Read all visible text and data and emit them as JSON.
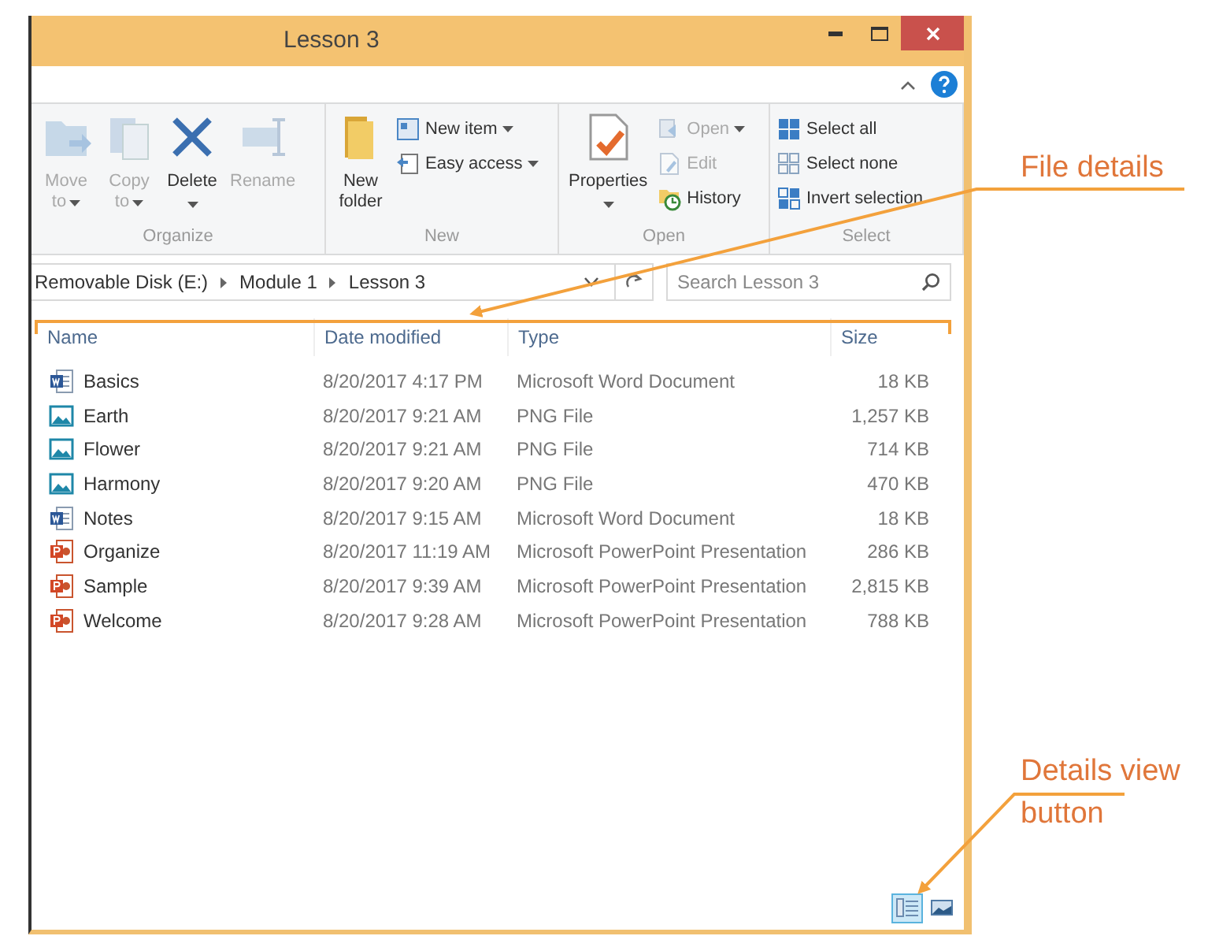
{
  "window": {
    "title": "Lesson 3"
  },
  "ribbon": {
    "groups": [
      {
        "label": "Organize",
        "buttons": [
          {
            "kind": "large",
            "label": "Move",
            "label2": "to",
            "disabled": true,
            "dropdown": true
          },
          {
            "kind": "large",
            "label": "Copy",
            "label2": "to",
            "disabled": true,
            "dropdown": true
          },
          {
            "kind": "large",
            "label": "Delete",
            "disabled": false,
            "dropdown": true
          },
          {
            "kind": "large",
            "label": "Rename",
            "disabled": true,
            "dropdown": false
          }
        ]
      },
      {
        "label": "New",
        "buttons": [
          {
            "kind": "large",
            "label": "New",
            "label2": "folder",
            "disabled": false,
            "dropdown": false
          },
          {
            "kind": "small",
            "label": "New item",
            "disabled": false,
            "dropdown": true
          },
          {
            "kind": "small",
            "label": "Easy access",
            "disabled": false,
            "dropdown": true
          }
        ]
      },
      {
        "label": "Open",
        "buttons": [
          {
            "kind": "large",
            "label": "Properties",
            "disabled": false,
            "dropdown": true
          },
          {
            "kind": "small",
            "label": "Open",
            "disabled": true,
            "dropdown": true
          },
          {
            "kind": "small",
            "label": "Edit",
            "disabled": true,
            "dropdown": false
          },
          {
            "kind": "small",
            "label": "History",
            "disabled": false,
            "dropdown": false
          }
        ]
      },
      {
        "label": "Select",
        "buttons": [
          {
            "kind": "small",
            "label": "Select all",
            "disabled": false,
            "dropdown": false
          },
          {
            "kind": "small",
            "label": "Select none",
            "disabled": false,
            "dropdown": false
          },
          {
            "kind": "small",
            "label": "Invert selection",
            "disabled": false,
            "dropdown": false
          }
        ]
      }
    ]
  },
  "address": {
    "path": [
      "Removable Disk (E:)",
      "Module 1",
      "Lesson 3"
    ],
    "search": {
      "placeholder": "Search Lesson 3"
    }
  },
  "table": {
    "columns": [
      "Name",
      "Date modified",
      "Type",
      "Size"
    ],
    "rows": [
      {
        "kind": "word",
        "name": "Basics",
        "date": "8/20/2017 4:17 PM",
        "type": "Microsoft Word Document",
        "size": "18 KB"
      },
      {
        "kind": "image",
        "name": "Earth",
        "date": "8/20/2017 9:21 AM",
        "type": "PNG File",
        "size": "1,257 KB"
      },
      {
        "kind": "image",
        "name": "Flower",
        "date": "8/20/2017 9:21 AM",
        "type": "PNG File",
        "size": "714 KB"
      },
      {
        "kind": "image",
        "name": "Harmony",
        "date": "8/20/2017 9:20 AM",
        "type": "PNG File",
        "size": "470 KB"
      },
      {
        "kind": "word",
        "name": "Notes",
        "date": "8/20/2017 9:15 AM",
        "type": "Microsoft Word Document",
        "size": "18 KB"
      },
      {
        "kind": "powerpoint",
        "name": "Organize",
        "date": "8/20/2017 11:19 AM",
        "type": "Microsoft PowerPoint Presentation",
        "size": "286 KB"
      },
      {
        "kind": "powerpoint",
        "name": "Sample",
        "date": "8/20/2017 9:39 AM",
        "type": "Microsoft PowerPoint Presentation",
        "size": "2,815 KB"
      },
      {
        "kind": "powerpoint",
        "name": "Welcome",
        "date": "8/20/2017 9:28 AM",
        "type": "Microsoft PowerPoint Presentation",
        "size": "788 KB"
      }
    ]
  },
  "status_bar": {
    "view_buttons": [
      {
        "kind": "details",
        "selected": true
      },
      {
        "kind": "large_icons",
        "selected": false
      }
    ]
  },
  "callouts": [
    {
      "lines": [
        "File details"
      ]
    },
    {
      "lines": [
        "Details view",
        "button"
      ]
    }
  ]
}
